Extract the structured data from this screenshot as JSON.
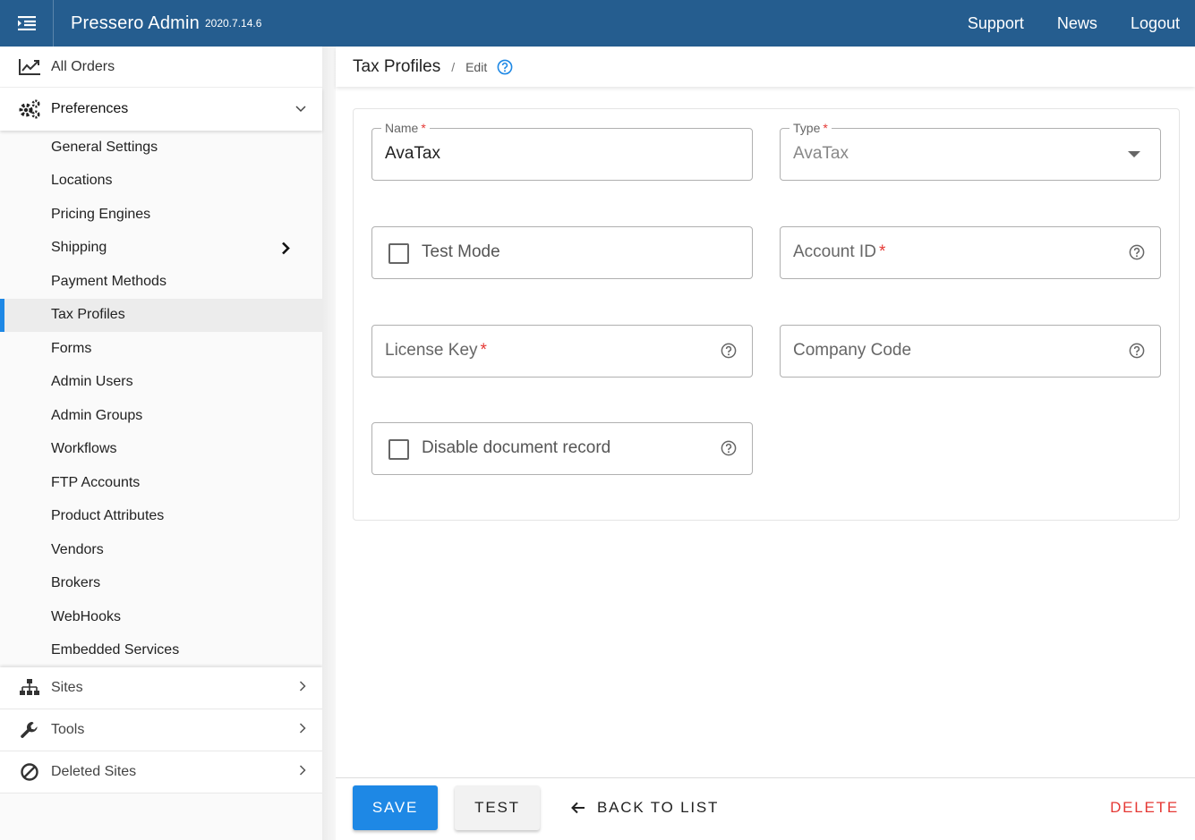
{
  "header": {
    "title": "Pressero Admin",
    "version": "2020.7.14.6",
    "links": [
      "Support",
      "News",
      "Logout"
    ]
  },
  "sidebar": {
    "all_orders": "All Orders",
    "preferences": "Preferences",
    "sub_items": [
      "General Settings",
      "Locations",
      "Pricing Engines",
      "Shipping",
      "Payment Methods",
      "Tax Profiles",
      "Forms",
      "Admin Users",
      "Admin Groups",
      "Workflows",
      "FTP Accounts",
      "Product Attributes",
      "Vendors",
      "Brokers",
      "WebHooks",
      "Embedded Services"
    ],
    "active_item": "Tax Profiles",
    "bottom_items": [
      "Sites",
      "Tools",
      "Deleted Sites"
    ]
  },
  "breadcrumb": {
    "main": "Tax Profiles",
    "separator": "/",
    "sub": "Edit"
  },
  "form": {
    "name": {
      "label": "Name",
      "required": "*",
      "value": "AvaTax"
    },
    "type": {
      "label": "Type",
      "required": "*",
      "value": "AvaTax"
    },
    "test_mode": {
      "label": "Test Mode"
    },
    "account_id": {
      "label": "Account ID",
      "required": "*"
    },
    "license_key": {
      "label": "License Key",
      "required": "*"
    },
    "company_code": {
      "label": "Company Code"
    },
    "disable_doc": {
      "label": "Disable document record"
    }
  },
  "footer": {
    "save": "SAVE",
    "test": "TEST",
    "back": "BACK TO LIST",
    "delete": "DELETE"
  },
  "colors": {
    "topbar": "#255d8f",
    "primary": "#1e88e5",
    "danger": "#e53935"
  }
}
